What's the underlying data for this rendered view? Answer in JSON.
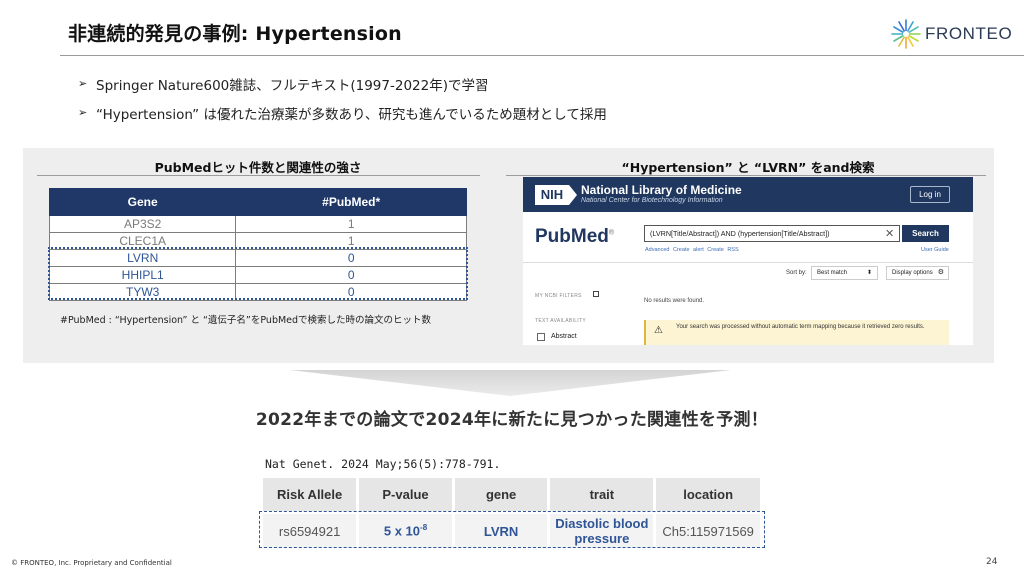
{
  "slide": {
    "title": "非連続的発見の事例: Hypertension",
    "logo_text": "FRONTEO",
    "bullets": [
      "Springer Nature600雑誌、フルテキスト(1997-2022年)で学習",
      "“Hypertension” は優れた治療薬が多数あり、研究も進んでいるため題材として採用"
    ],
    "bullet_marker": "➢",
    "headline": "2022年までの論文で2024年に新たに見つかった関連性を予測！",
    "citation": "Nat Genet. 2024 May;56(5):778-791.",
    "copyright": "© FRONTEO, Inc.  Proprietary and Confidential",
    "page_number": "24"
  },
  "left_panel": {
    "title": "PubMedヒット件数と関連性の強さ",
    "columns": [
      "Gene",
      "#PubMed*"
    ],
    "rows": [
      {
        "gene": "AP3S2",
        "count": "1"
      },
      {
        "gene": "CLEC1A",
        "count": "1"
      },
      {
        "gene": "LVRN",
        "count": "0"
      },
      {
        "gene": "HHIPL1",
        "count": "0"
      },
      {
        "gene": "TYW3",
        "count": "0"
      }
    ],
    "footnote": "#PubMed : “Hypertension” と “遺伝子名”をPubMedで検索した時の論文のヒット数"
  },
  "right_panel": {
    "title": "“Hypertension” と “LVRN” をand検索",
    "pubmed": {
      "nih_badge": "NIH",
      "nlm_title": "National Library of Medicine",
      "nlm_subtitle": "National Center for Biotechnology Information",
      "login_label": "Log in",
      "logo_text": "PubMed",
      "logo_mark": "®",
      "query": "(LVRN[Title/Abstract]) AND (hypertension[Title/Abstract])",
      "clear_glyph": "✕",
      "search_label": "Search",
      "links": [
        "Advanced",
        "Create alert",
        "Create RSS"
      ],
      "user_guide": "User Guide",
      "sort_label": "Sort by:",
      "sort_value": "Best match",
      "display_label": "Display options",
      "filters_label": "MY NCBI FILTERS",
      "no_results": "No results were found.",
      "availability_label": "TEXT AVAILABILITY",
      "abstract_label": "Abstract",
      "alert_text": "Your search was processed without automatic term mapping because it retrieved zero results."
    }
  },
  "risk_table": {
    "columns": [
      "Risk Allele",
      "P-value",
      "gene",
      "trait",
      "location"
    ],
    "row": {
      "risk_allele": "rs6594921",
      "p_value_base": "5 x 10",
      "p_value_exp": "-8",
      "gene": "LVRN",
      "trait_line1": "Diastolic blood",
      "trait_line2": "pressure",
      "location": "Ch5:115971569"
    }
  },
  "colors": {
    "table_header": "#1f3868",
    "highlight_blue": "#2e5596",
    "pubmed_navy": "#20385f",
    "panel_bg": "#eeeeee"
  }
}
